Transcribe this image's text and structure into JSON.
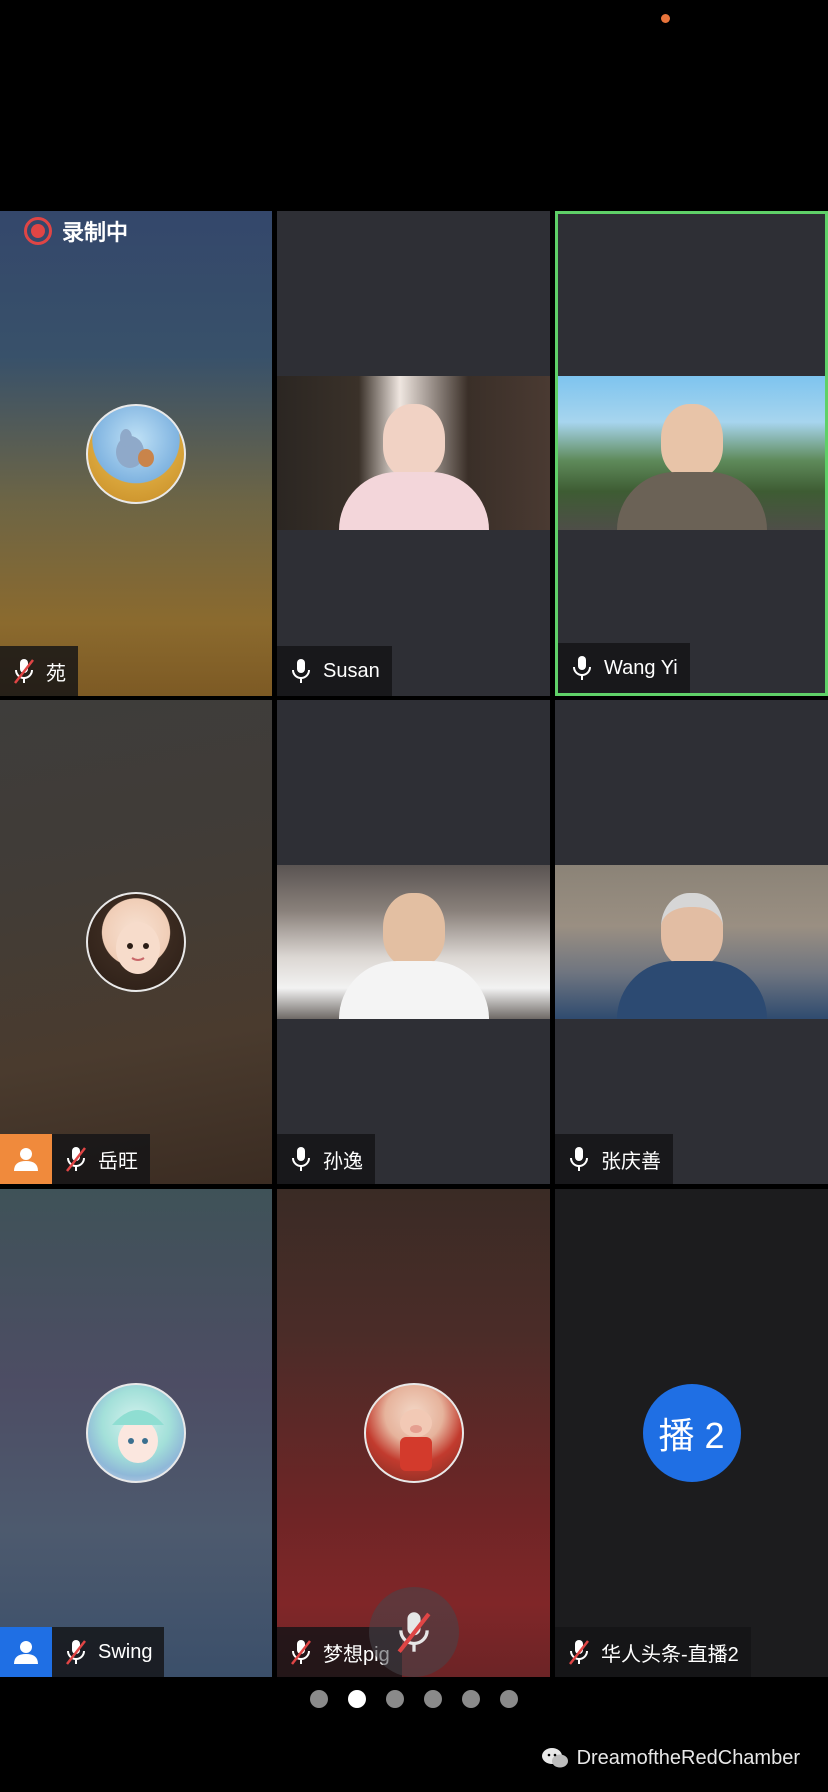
{
  "recording": {
    "label": "录制中"
  },
  "participants": [
    {
      "name": "苑",
      "mic": "muted",
      "avatar": "tom-and-jerry-avatar"
    },
    {
      "name": "Susan",
      "mic": "on",
      "video": true
    },
    {
      "name": "Wang Yi",
      "mic": "on",
      "video": true,
      "active_speaker": true
    },
    {
      "name": "岳旺",
      "mic": "muted",
      "avatar": "girl-avatar",
      "badge": "user-icon-orange"
    },
    {
      "name": "孙逸",
      "mic": "on",
      "video": true
    },
    {
      "name": "张庆善",
      "mic": "on",
      "video": true
    },
    {
      "name": "Swing",
      "mic": "muted",
      "avatar": "anime-elf-avatar",
      "badge": "user-icon-blue"
    },
    {
      "name": "梦想pig",
      "mic": "muted",
      "avatar": "pig-figurine-avatar"
    },
    {
      "name": "华人头条-直播2",
      "mic": "muted",
      "broadcast_label": "播 2"
    }
  ],
  "pager": {
    "count": 6,
    "current": 1
  },
  "watermark": {
    "text": "DreamoftheRedChamber"
  },
  "colors": {
    "active_border": "#5fd068",
    "recording": "#e04545",
    "broadcast": "#1f6fe4"
  }
}
